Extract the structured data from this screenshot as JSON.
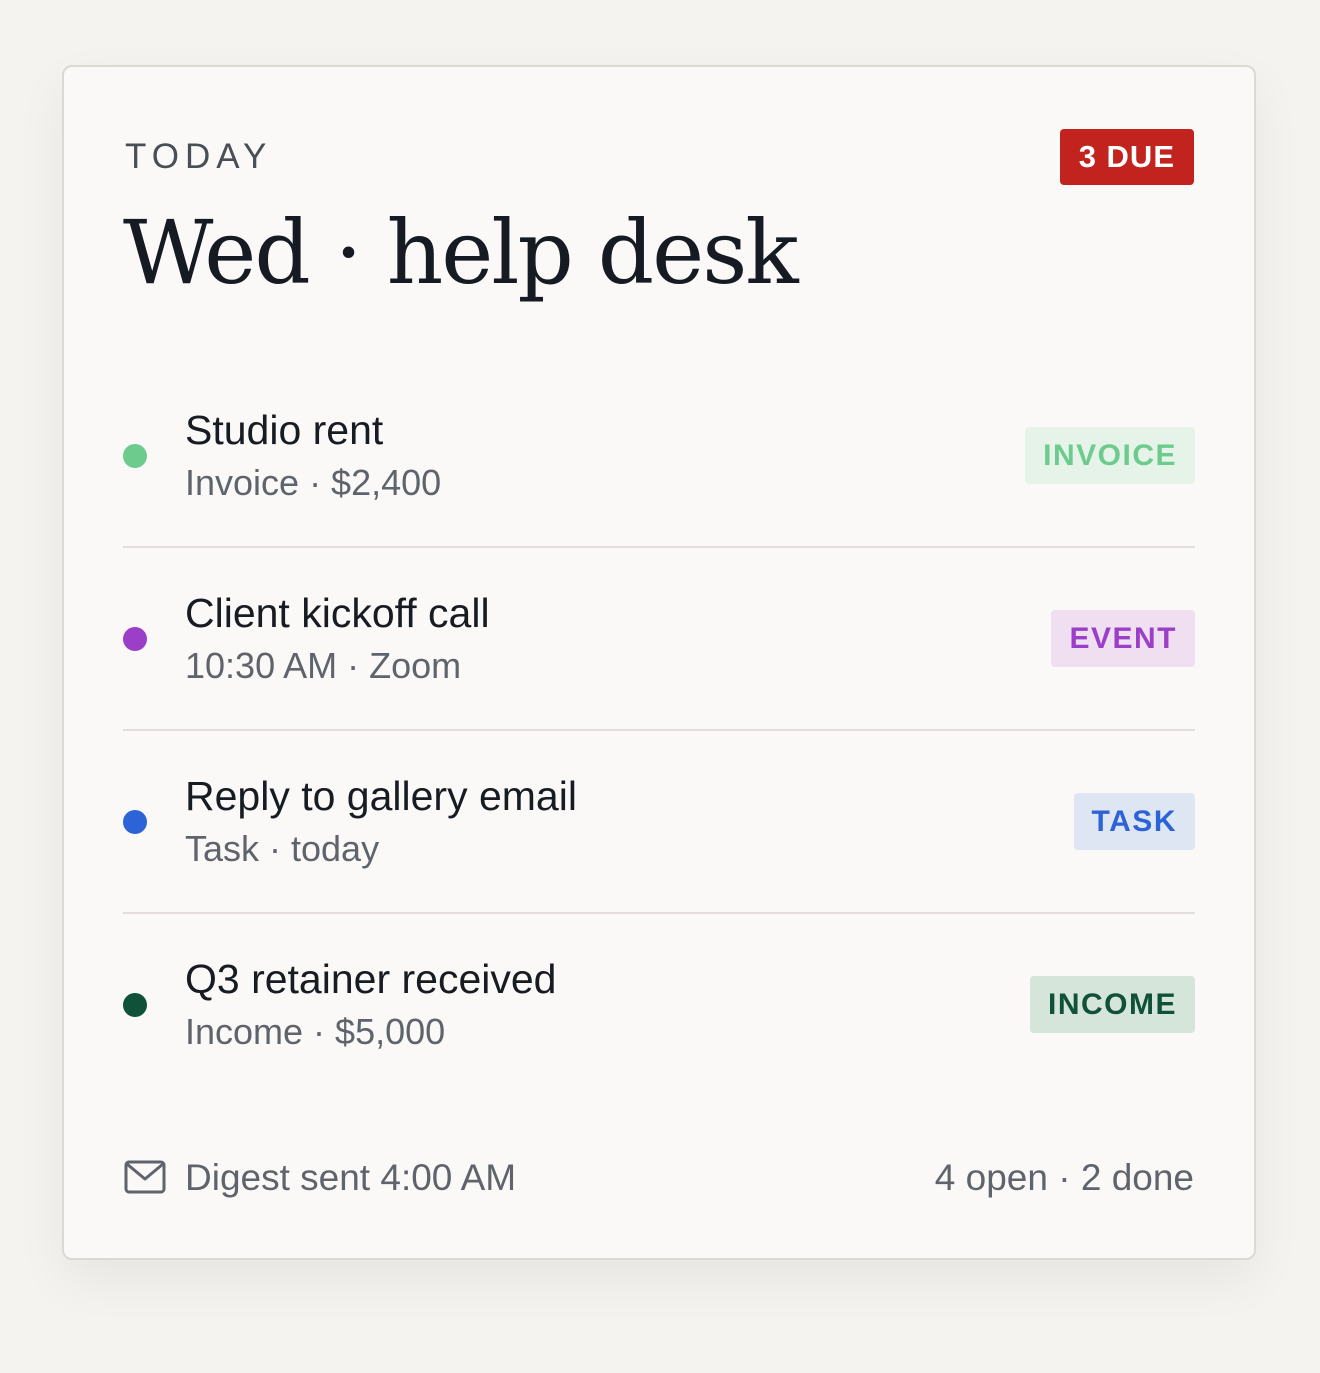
{
  "header": {
    "eyebrow": "TODAY",
    "title": "Wed · help desk",
    "due_badge": "3 DUE",
    "due_badge_color": "#c3231e"
  },
  "items": [
    {
      "title": "Studio rent",
      "subtitle": "Invoice · $2,400",
      "tag": "INVOICE",
      "dot_color": "#6dcb8d",
      "tag_bg": "#e5f3e8",
      "tag_color": "#6dcb8d"
    },
    {
      "title": "Client kickoff call",
      "subtitle": "10:30 AM · Zoom",
      "tag": "EVENT",
      "dot_color": "#9b3fc9",
      "tag_bg": "#efdff0",
      "tag_color": "#9b3fc9"
    },
    {
      "title": "Reply to gallery email",
      "subtitle": "Task · today",
      "tag": "TASK",
      "dot_color": "#2c63d6",
      "tag_bg": "#dfe6f3",
      "tag_color": "#2c63d6"
    },
    {
      "title": "Q3 retainer received",
      "subtitle": "Income · $5,000",
      "tag": "INCOME",
      "dot_color": "#10513a",
      "tag_bg": "#d5e5da",
      "tag_color": "#10513a"
    }
  ],
  "footer": {
    "icon": "mail-icon",
    "digest": "Digest sent 4:00 AM",
    "summary": "4 open · 2 done"
  }
}
